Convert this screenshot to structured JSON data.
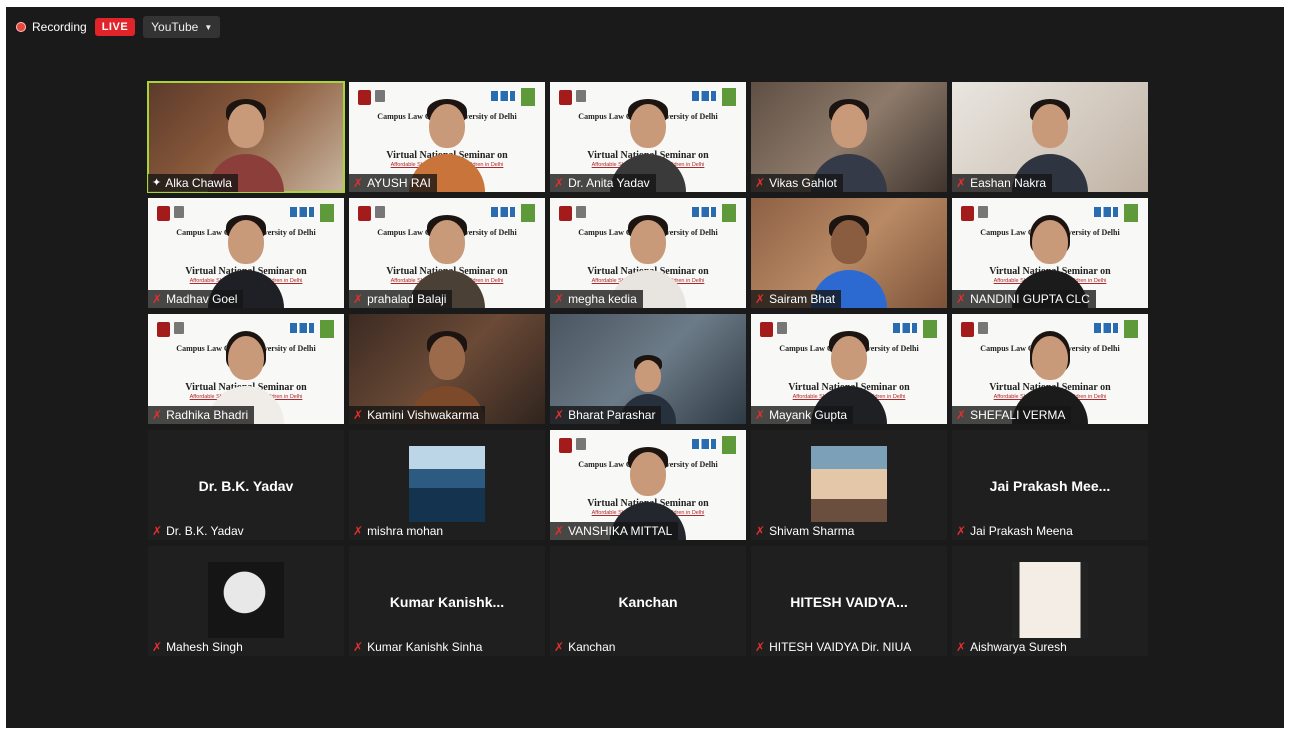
{
  "topbar": {
    "recording_label": "Recording",
    "live_label": "LIVE",
    "stream_target": "YouTube"
  },
  "banner_text": {
    "title": "Campus Law Centre, University of Delhi",
    "subtitle": "Virtual National Seminar on",
    "tagline": "Affordable Shelters for Street Children in Delhi"
  },
  "participants": [
    {
      "name": "Alka Chawla",
      "status": "pinned",
      "active_speaker": true
    },
    {
      "name": "AYUSH RAI",
      "status": "muted"
    },
    {
      "name": "Dr. Anita Yadav",
      "status": "muted"
    },
    {
      "name": "Vikas Gahlot",
      "status": "muted"
    },
    {
      "name": "Eashan Nakra",
      "status": "muted"
    },
    {
      "name": "Madhav Goel",
      "status": "muted"
    },
    {
      "name": "prahalad Balaji",
      "status": "muted"
    },
    {
      "name": "megha kedia",
      "status": "muted"
    },
    {
      "name": "Sairam Bhat",
      "status": "muted"
    },
    {
      "name": "NANDINI GUPTA CLC",
      "status": "muted"
    },
    {
      "name": "Radhika Bhadri",
      "status": "muted"
    },
    {
      "name": "Kamini Vishwakarma",
      "status": "muted"
    },
    {
      "name": "Bharat Parashar",
      "status": "muted"
    },
    {
      "name": "Mayank Gupta",
      "status": "muted"
    },
    {
      "name": "SHEFALI VERMA",
      "status": "muted"
    },
    {
      "name": "Dr. B.K. Yadav",
      "display": "Dr. B.K. Yadav",
      "status": "muted"
    },
    {
      "name": "mishra mohan",
      "status": "muted"
    },
    {
      "name": "VANSHIKA MITTAL",
      "status": "muted"
    },
    {
      "name": "Shivam Sharma",
      "status": "muted"
    },
    {
      "name": "Jai Prakash Meena",
      "display": "Jai Prakash Mee...",
      "status": "muted"
    },
    {
      "name": "Mahesh Singh",
      "status": "muted"
    },
    {
      "name": "Kumar Kanishk Sinha",
      "display": "Kumar Kanishk...",
      "status": "muted"
    },
    {
      "name": "Kanchan",
      "display": "Kanchan",
      "status": "muted"
    },
    {
      "name": "HITESH VAIDYA Dir. NIUA",
      "display": "HITESH VAIDYA...",
      "status": "muted"
    },
    {
      "name": "Aishwarya Suresh",
      "status": "muted"
    }
  ],
  "icons": {
    "muted": "mic-off-icon",
    "pinned": "pin-icon",
    "record": "record-dot-icon",
    "dropdown": "caret-down-icon"
  },
  "colors": {
    "background": "#1a1a1a",
    "live": "#e0242a",
    "active_speaker_border": "#a8d43a",
    "mic_off": "#e0302e"
  }
}
